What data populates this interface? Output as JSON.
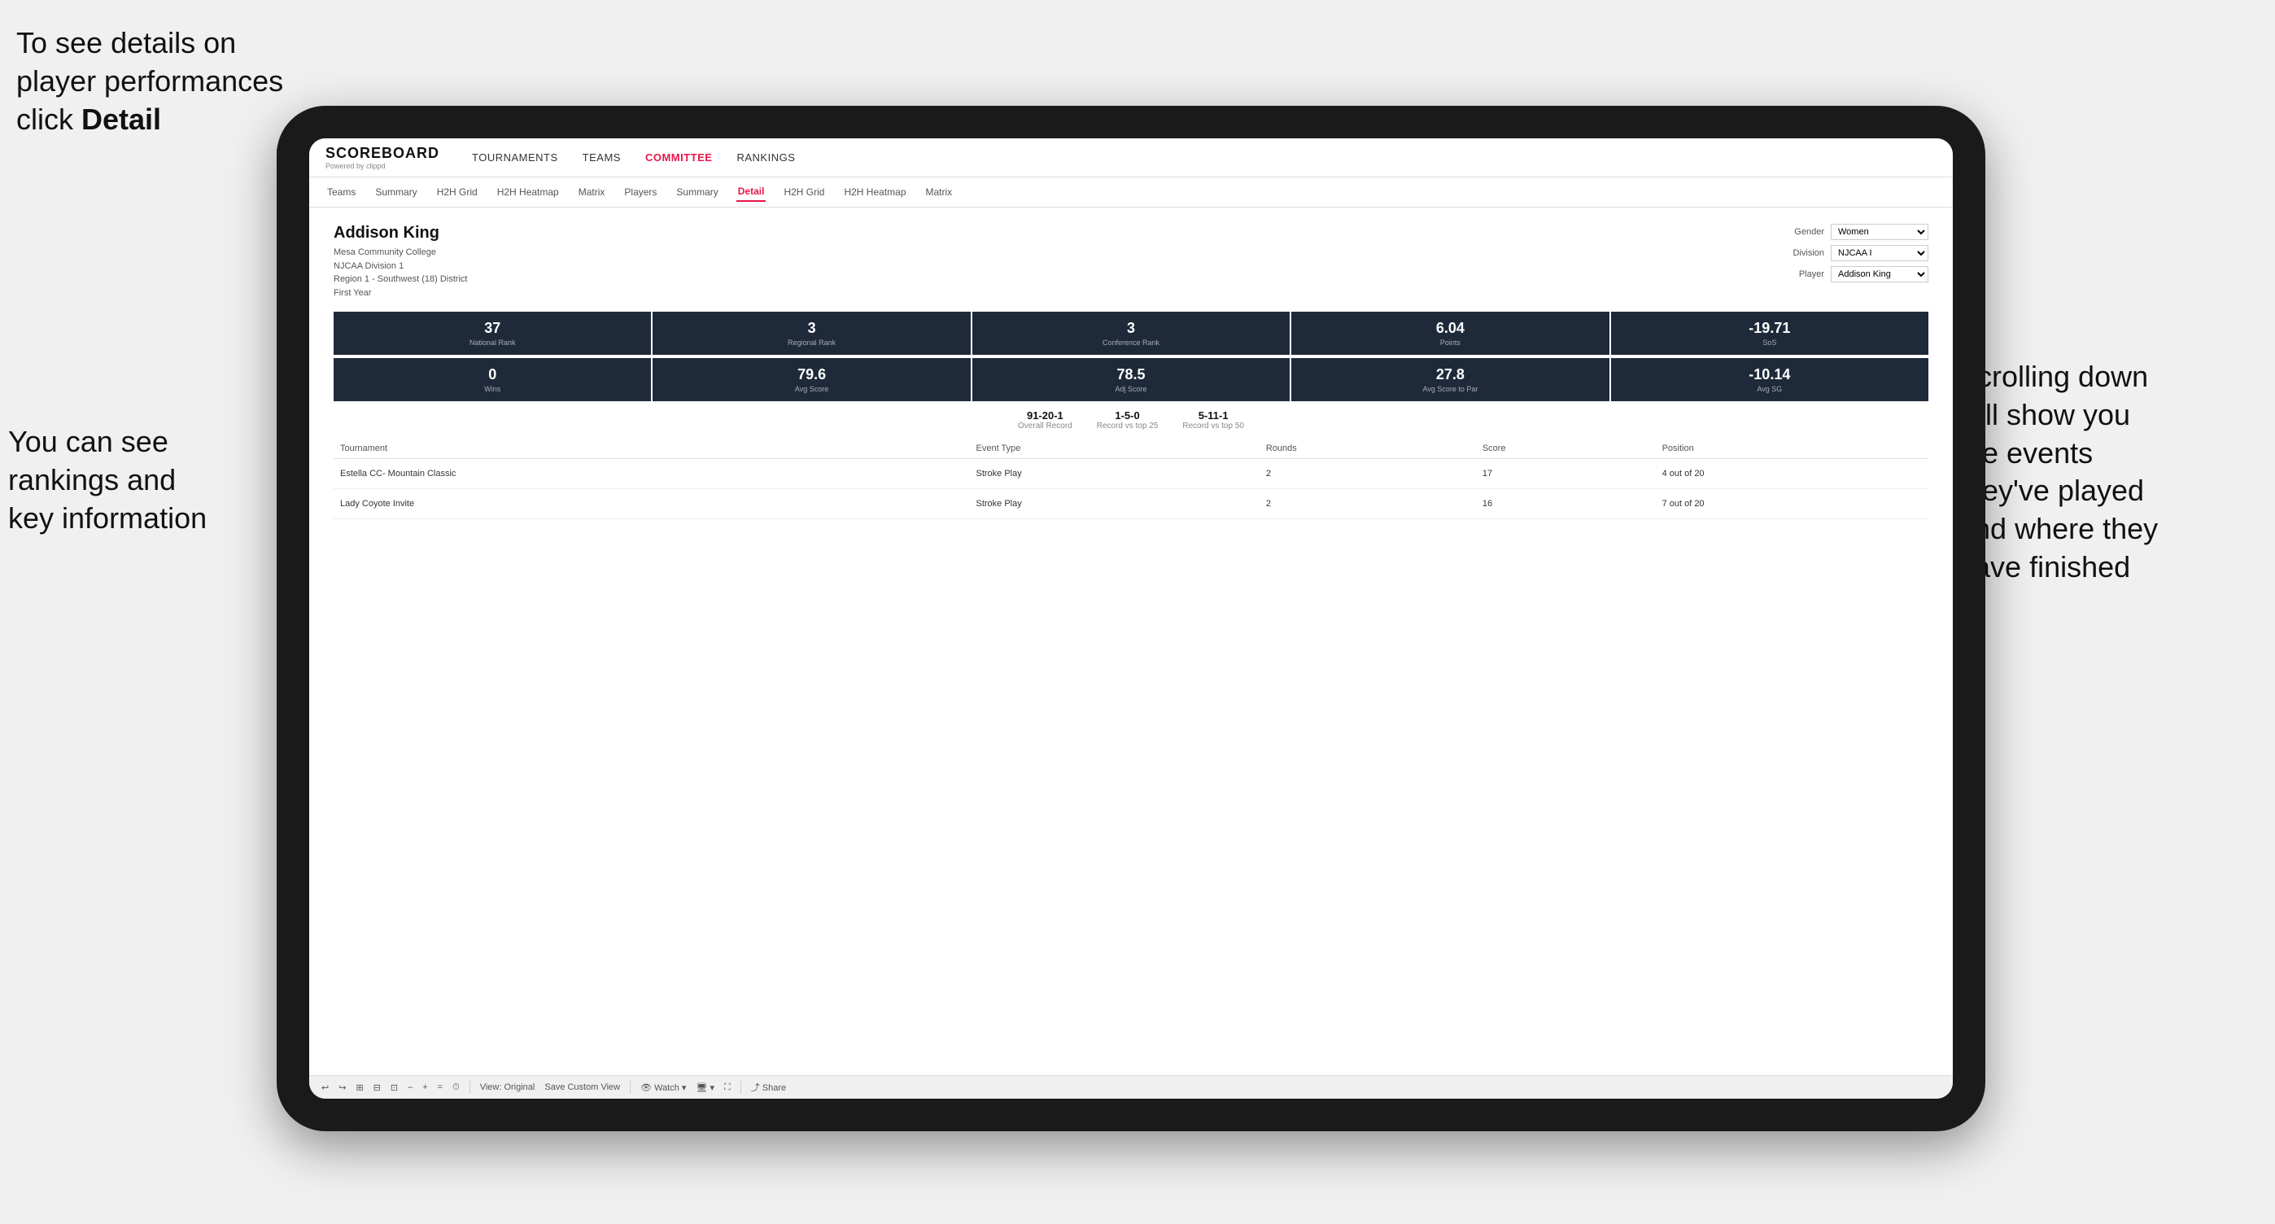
{
  "annotations": {
    "top_left": {
      "line1": "To see details on",
      "line2": "player performances",
      "line3": "click ",
      "line3_bold": "Detail"
    },
    "bottom_left": {
      "line1": "You can see",
      "line2": "rankings and",
      "line3": "key information"
    },
    "right": {
      "line1": "Scrolling down",
      "line2": "will show you",
      "line3": "the events",
      "line4": "they've played",
      "line5": "and where they",
      "line6": "have finished"
    }
  },
  "nav": {
    "logo": "SCOREBOARD",
    "logo_sub": "Powered by clippd",
    "items": [
      "TOURNAMENTS",
      "TEAMS",
      "COMMITTEE",
      "RANKINGS"
    ]
  },
  "sub_nav": {
    "items": [
      "Teams",
      "Summary",
      "H2H Grid",
      "H2H Heatmap",
      "Matrix",
      "Players",
      "Summary",
      "Detail",
      "H2H Grid",
      "H2H Heatmap",
      "Matrix"
    ]
  },
  "player": {
    "name": "Addison King",
    "school": "Mesa Community College",
    "division": "NJCAA Division 1",
    "region": "Region 1 - Southwest (18) District",
    "year": "First Year",
    "gender_label": "Gender",
    "gender_value": "Women",
    "division_label": "Division",
    "division_value": "NJCAA I",
    "player_label": "Player",
    "player_value": "Addison King"
  },
  "stats_row1": [
    {
      "value": "37",
      "label": "National Rank"
    },
    {
      "value": "3",
      "label": "Regional Rank"
    },
    {
      "value": "3",
      "label": "Conference Rank"
    },
    {
      "value": "6.04",
      "label": "Points"
    },
    {
      "value": "-19.71",
      "label": "SoS"
    }
  ],
  "stats_row2": [
    {
      "value": "0",
      "label": "Wins"
    },
    {
      "value": "79.6",
      "label": "Avg Score"
    },
    {
      "value": "78.5",
      "label": "Adj Score"
    },
    {
      "value": "27.8",
      "label": "Avg Score to Par"
    },
    {
      "value": "-10.14",
      "label": "Avg SG"
    }
  ],
  "records": [
    {
      "value": "91-20-1",
      "label": "Overall Record"
    },
    {
      "value": "1-5-0",
      "label": "Record vs top 25"
    },
    {
      "value": "5-11-1",
      "label": "Record vs top 50"
    }
  ],
  "table": {
    "headers": [
      "Tournament",
      "Event Type",
      "Rounds",
      "Score",
      "Position"
    ],
    "rows": [
      {
        "tournament": "Estella CC- Mountain Classic",
        "event_type": "Stroke Play",
        "rounds": "2",
        "score": "17",
        "position": "4 out of 20"
      },
      {
        "tournament": "Lady Coyote Invite",
        "event_type": "Stroke Play",
        "rounds": "2",
        "score": "16",
        "position": "7 out of 20"
      }
    ]
  },
  "toolbar": {
    "items": [
      "↩",
      "↪",
      "⊞",
      "⊟",
      "⊡",
      "–",
      "+",
      "=",
      "⏱",
      "View: Original",
      "Save Custom View",
      "Watch ▾",
      "🖥 ▾",
      "⛶",
      "Share"
    ]
  }
}
